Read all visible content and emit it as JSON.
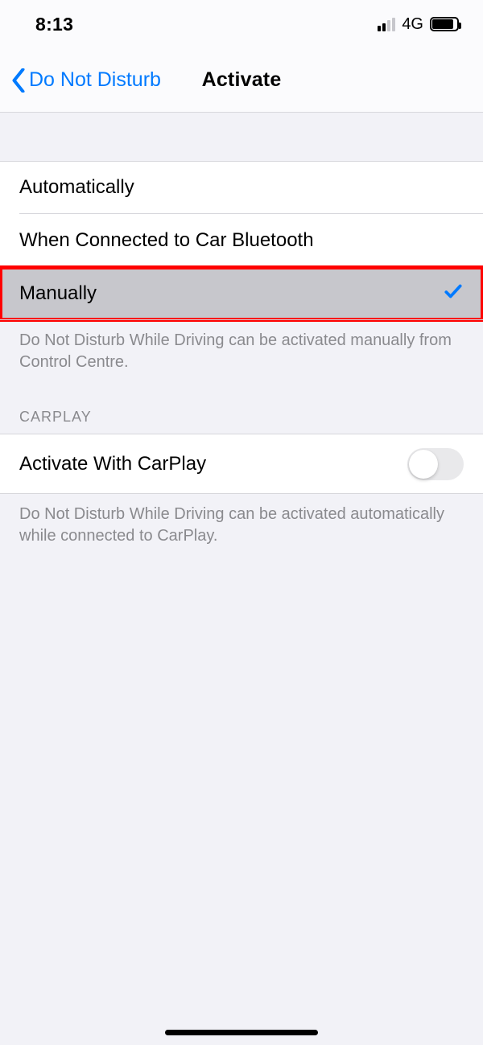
{
  "status": {
    "time": "8:13",
    "network_label": "4G"
  },
  "nav": {
    "back_label": "Do Not Disturb",
    "title": "Activate"
  },
  "activation": {
    "options": [
      {
        "label": "Automatically",
        "selected": false
      },
      {
        "label": "When Connected to Car Bluetooth",
        "selected": false
      },
      {
        "label": "Manually",
        "selected": true
      }
    ],
    "footer": "Do Not Disturb While Driving can be activated manually from Control Centre."
  },
  "carplay": {
    "header": "CARPLAY",
    "toggle_label": "Activate With CarPlay",
    "toggle_on": false,
    "footer": "Do Not Disturb While Driving can be activated automatically while connected to CarPlay."
  }
}
